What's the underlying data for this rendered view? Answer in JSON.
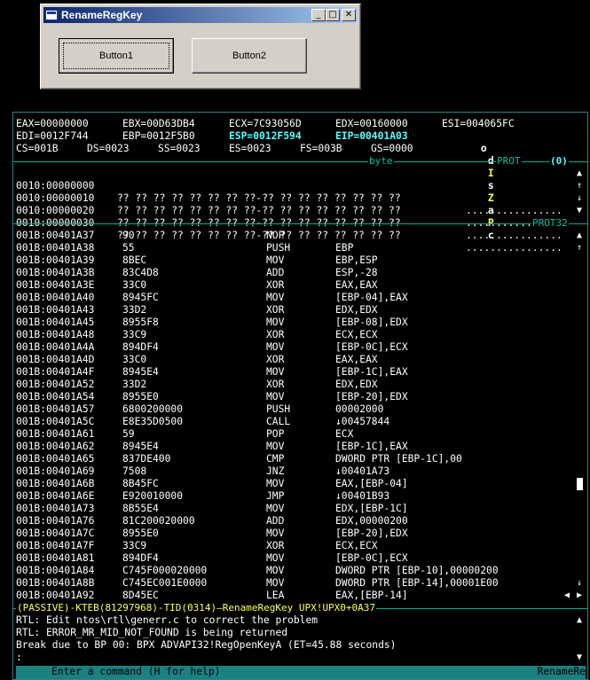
{
  "dialog": {
    "title": "RenameRegKey",
    "minimize_glyph": "_",
    "maximize_glyph": "□",
    "close_glyph": "✕",
    "button1_label": "Button1",
    "button2_label": "Button2"
  },
  "registers": {
    "row1": [
      "EAX=00000000",
      "EBX=00D63DB4",
      "ECX=7C93056D",
      "EDX=00160000",
      "ESI=004065FC"
    ],
    "row2": [
      "EDI=0012F744",
      "EBP=0012F5B0",
      "ESP=0012F594",
      "EIP=00401A03"
    ],
    "flags": [
      "o",
      "d",
      "I",
      "s",
      "Z",
      "a",
      "P",
      "c"
    ],
    "row3": [
      "CS=001B",
      "DS=0023",
      "SS=0023",
      "ES=0023",
      "FS=003B",
      "GS=0000"
    ]
  },
  "data_header": {
    "label": "byte",
    "mode": "PROT",
    "index": "(0)"
  },
  "data_lines": [
    {
      "addr": "0010:00000000",
      "hex": "?? ?? ?? ?? ?? ?? ?? ??-?? ?? ?? ?? ?? ?? ?? ??",
      "ascii": "................"
    },
    {
      "addr": "0010:00000010",
      "hex": "?? ?? ?? ?? ?? ?? ?? ??-?? ?? ?? ?? ?? ?? ?? ??",
      "ascii": "................"
    },
    {
      "addr": "0010:00000020",
      "hex": "?? ?? ?? ?? ?? ?? ?? ??-?? ?? ?? ?? ?? ?? ?? ??",
      "ascii": "................"
    },
    {
      "addr": "0010:00000030",
      "hex": "?? ?? ?? ?? ?? ?? ?? ??-?? ?? ?? ?? ?? ?? ?? ??",
      "ascii": "................"
    }
  ],
  "code_header": {
    "mode": "PROT32"
  },
  "code_lines": [
    {
      "addr": "001B:00401A37",
      "bytes": "90",
      "mnem": "NOP",
      "ops": ""
    },
    {
      "addr": "001B:00401A38",
      "bytes": "55",
      "mnem": "PUSH",
      "ops": "EBP"
    },
    {
      "addr": "001B:00401A39",
      "bytes": "8BEC",
      "mnem": "MOV",
      "ops": "EBP,ESP"
    },
    {
      "addr": "001B:00401A3B",
      "bytes": "83C4D8",
      "mnem": "ADD",
      "ops": "ESP,-28"
    },
    {
      "addr": "001B:00401A3E",
      "bytes": "33C0",
      "mnem": "XOR",
      "ops": "EAX,EAX"
    },
    {
      "addr": "001B:00401A40",
      "bytes": "8945FC",
      "mnem": "MOV",
      "ops": "[EBP-04],EAX"
    },
    {
      "addr": "001B:00401A43",
      "bytes": "33D2",
      "mnem": "XOR",
      "ops": "EDX,EDX"
    },
    {
      "addr": "001B:00401A45",
      "bytes": "8955F8",
      "mnem": "MOV",
      "ops": "[EBP-08],EDX"
    },
    {
      "addr": "001B:00401A48",
      "bytes": "33C9",
      "mnem": "XOR",
      "ops": "ECX,ECX"
    },
    {
      "addr": "001B:00401A4A",
      "bytes": "894DF4",
      "mnem": "MOV",
      "ops": "[EBP-0C],ECX"
    },
    {
      "addr": "001B:00401A4D",
      "bytes": "33C0",
      "mnem": "XOR",
      "ops": "EAX,EAX"
    },
    {
      "addr": "001B:00401A4F",
      "bytes": "8945E4",
      "mnem": "MOV",
      "ops": "[EBP-1C],EAX"
    },
    {
      "addr": "001B:00401A52",
      "bytes": "33D2",
      "mnem": "XOR",
      "ops": "EDX,EDX"
    },
    {
      "addr": "001B:00401A54",
      "bytes": "8955E0",
      "mnem": "MOV",
      "ops": "[EBP-20],EDX"
    },
    {
      "addr": "001B:00401A57",
      "bytes": "6800200000",
      "mnem": "PUSH",
      "ops": "00002000"
    },
    {
      "addr": "001B:00401A5C",
      "bytes": "E8E35D0500",
      "mnem": "CALL",
      "ops": "↓00457844"
    },
    {
      "addr": "001B:00401A61",
      "bytes": "59",
      "mnem": "POP",
      "ops": "ECX"
    },
    {
      "addr": "001B:00401A62",
      "bytes": "8945E4",
      "mnem": "MOV",
      "ops": "[EBP-1C],EAX"
    },
    {
      "addr": "001B:00401A65",
      "bytes": "837DE400",
      "mnem": "CMP",
      "ops": "DWORD PTR [EBP-1C],00"
    },
    {
      "addr": "001B:00401A69",
      "bytes": "7508",
      "mnem": "JNZ",
      "ops": "↓00401A73"
    },
    {
      "addr": "001B:00401A6B",
      "bytes": "8B45FC",
      "mnem": "MOV",
      "ops": "EAX,[EBP-04]"
    },
    {
      "addr": "001B:00401A6E",
      "bytes": "E920010000",
      "mnem": "JMP",
      "ops": "↓00401B93"
    },
    {
      "addr": "001B:00401A73",
      "bytes": "8B55E4",
      "mnem": "MOV",
      "ops": "EDX,[EBP-1C]"
    },
    {
      "addr": "001B:00401A76",
      "bytes": "81C200020000",
      "mnem": "ADD",
      "ops": "EDX,00000200"
    },
    {
      "addr": "001B:00401A7C",
      "bytes": "8955E0",
      "mnem": "MOV",
      "ops": "[EBP-20],EDX"
    },
    {
      "addr": "001B:00401A7F",
      "bytes": "33C9",
      "mnem": "XOR",
      "ops": "ECX,ECX"
    },
    {
      "addr": "001B:00401A81",
      "bytes": "894DF4",
      "mnem": "MOV",
      "ops": "[EBP-0C],ECX"
    },
    {
      "addr": "001B:00401A84",
      "bytes": "C745F000020000",
      "mnem": "MOV",
      "ops": "DWORD PTR [EBP-10],00000200"
    },
    {
      "addr": "001B:00401A8B",
      "bytes": "C745EC001E0000",
      "mnem": "MOV",
      "ops": "DWORD PTR [EBP-14],00001E00"
    },
    {
      "addr": "001B:00401A92",
      "bytes": "8D45EC",
      "mnem": "LEA",
      "ops": "EAX,[EBP-14]"
    }
  ],
  "status_line": "(PASSIVE)-KTEB(81297968)-TID(0314)—RenameRegKey UPX!UPX0+0A37",
  "log_lines": [
    "RTL: Edit ntos\\rtl\\generr.c to correct the problem",
    "RTL: ERROR_MR_MID_NOT_FOUND is being returned",
    "Break due to BP 00: BPX ADVAPI32!RegOpenKeyA (ET=45.88 seconds)",
    ":"
  ],
  "command_bar": {
    "hint": "Enter a command (H for help)",
    "context": "RenameRe"
  },
  "scroll_glyphs": {
    "up": "▲",
    "down": "▼",
    "up_arrow": "↑",
    "down_arrow": "↓",
    "left": "◀",
    "right": "▶"
  },
  "colors": {
    "background": "#000000",
    "text": "#ffffff",
    "highlight_register": "#55ffff",
    "flag_set": "#ffff55",
    "separator": "#00b090",
    "status_text": "#ffff55",
    "command_bar_bg": "#1a8080",
    "title_gradient_start": "#0a246a",
    "dialog_face": "#d4d0c8"
  }
}
